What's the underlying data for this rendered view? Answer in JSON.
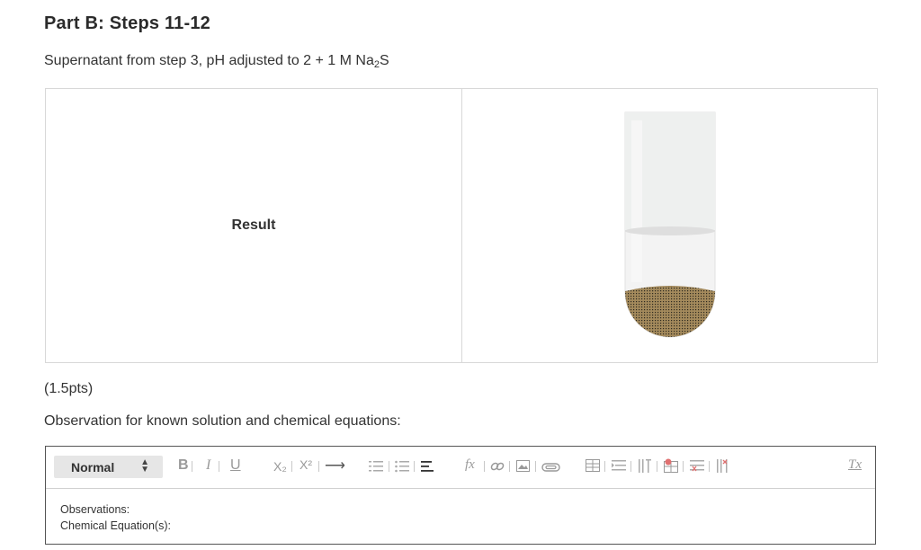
{
  "header": {
    "title": "Part B: Steps 11-12",
    "subtitle_prefix": "Supernatant from step 3, pH adjusted to 2 + 1 M Na",
    "subtitle_sub": "2",
    "subtitle_suffix": "S"
  },
  "result": {
    "label": "Result",
    "tube_icon": "test-tube-with-precipitate",
    "precipitate_color": "#a48a5c"
  },
  "question": {
    "points": "(1.5pts)",
    "prompt": "Observation for known solution and chemical equations:"
  },
  "editor": {
    "format_value": "Normal",
    "toolbar": {
      "bold": "B",
      "italic": "I",
      "underline": "U",
      "subscript": "X₂",
      "superscript": "X²",
      "arrow": "⟶",
      "formula": "fx",
      "clear": "Tx"
    },
    "body_lines": [
      "Observations:",
      "Chemical Equation(s):"
    ]
  }
}
